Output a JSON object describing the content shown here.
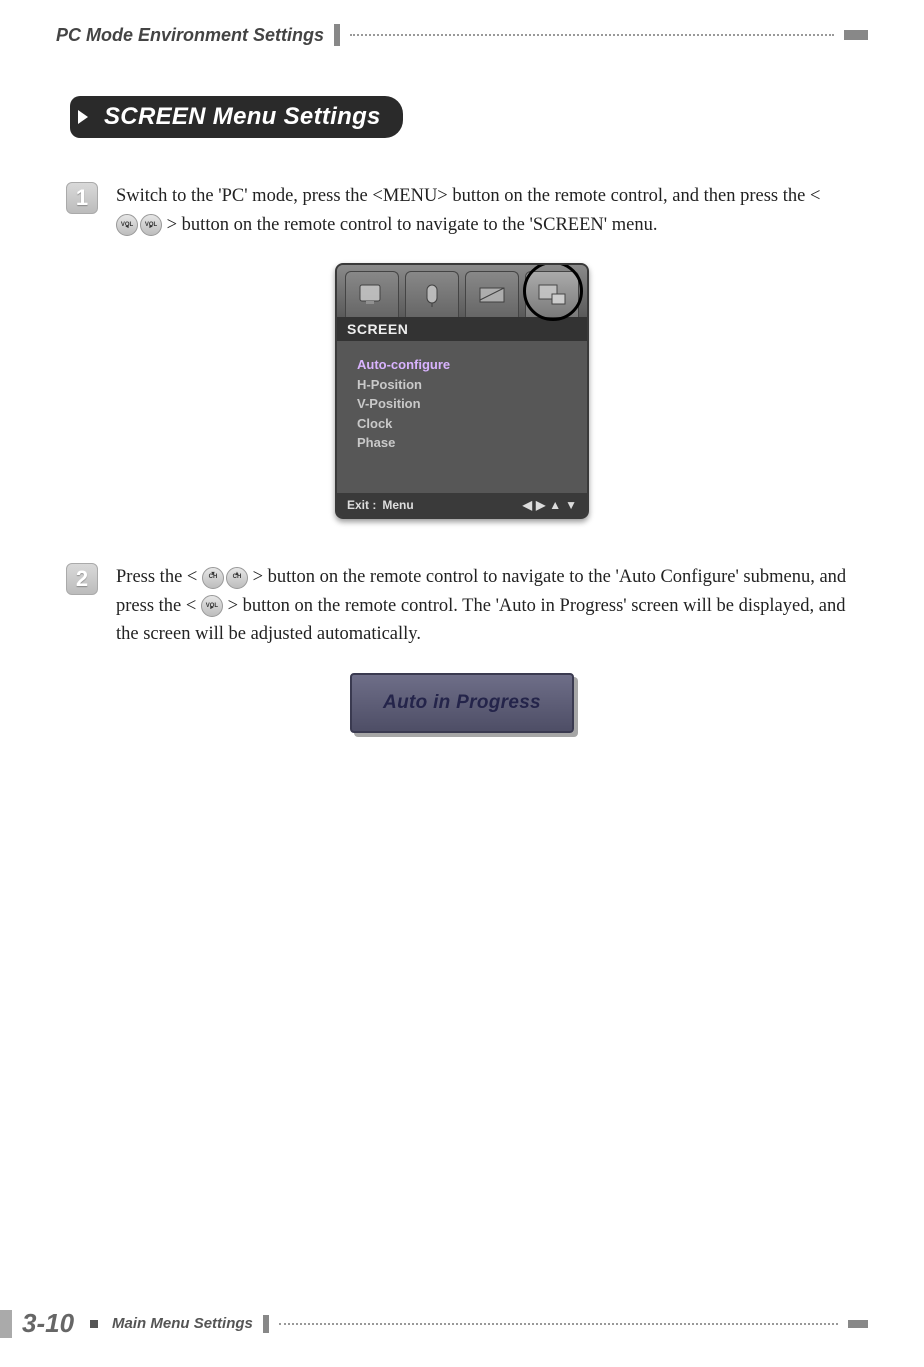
{
  "header": {
    "title": "PC Mode Environment Settings"
  },
  "section": {
    "title": "SCREEN Menu Settings"
  },
  "steps": {
    "s1": {
      "num": "1",
      "text_a": "Switch to the 'PC' mode, press the <MENU> button on the remote control, and then press the <",
      "text_b": "> button on the remote control to navigate to the 'SCREEN' menu."
    },
    "s2": {
      "num": "2",
      "text_a": "Press the <",
      "text_b": "> button on the remote control to navigate to the 'Auto Configure' submenu, and press the <",
      "text_c": "> button on the remote control. The 'Auto in Progress' screen will be displayed, and the screen will be adjusted automatically."
    }
  },
  "icon_labels": {
    "vol": "VOL",
    "ch": "CH"
  },
  "osd": {
    "title": "SCREEN",
    "items": [
      "Auto-configure",
      "H-Position",
      "V-Position",
      "Clock",
      "Phase"
    ],
    "exit": "Exit :",
    "menu": "Menu"
  },
  "aip": {
    "label": "Auto in Progress"
  },
  "footer": {
    "page": "3-10",
    "label": "Main Menu Settings"
  }
}
